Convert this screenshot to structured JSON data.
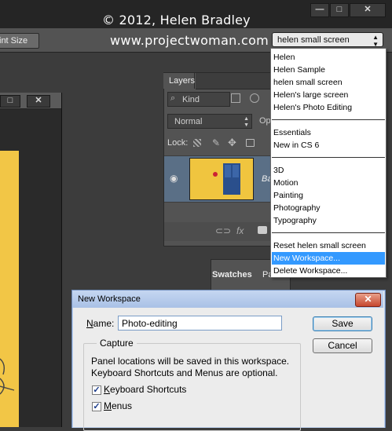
{
  "watermark": {
    "line1": "© 2012, Helen Bradley",
    "line2": "www.projectwoman.com"
  },
  "app_window": {
    "minimize": "—",
    "maximize": "□",
    "close": "✕"
  },
  "options_bar": {
    "print_size_label": "int Size",
    "workspace_select_value": "helen small screen"
  },
  "document_window": {
    "maximize": "□",
    "close": "✕"
  },
  "layers_panel": {
    "tab_label": "Layers",
    "kind_label": "Kind",
    "blend_mode": "Normal",
    "opacity_label": "Op",
    "lock_label": "Lock:",
    "layer_name": "Ba"
  },
  "swatches_panel": {
    "swatches_tab": "Swatches",
    "paths_tab": "Path"
  },
  "workspace_menu": {
    "group1": [
      "Helen",
      "Helen Sample",
      "helen small screen",
      "Helen's large screen",
      "Helen's Photo Editing"
    ],
    "group2": [
      "Essentials",
      "New in CS 6"
    ],
    "group3": [
      "3D",
      "Motion",
      "Painting",
      "Photography",
      "Typography"
    ],
    "group4": [
      "Reset helen small screen",
      "New Workspace...",
      "Delete Workspace..."
    ],
    "highlighted": "New Workspace..."
  },
  "dialog": {
    "title": "New Workspace",
    "name_label": "Name:",
    "name_value": "Photo-editing",
    "save_label": "Save",
    "cancel_label": "Cancel",
    "capture_label": "Capture",
    "info_line1": "Panel locations will be saved in this workspace.",
    "info_line2": "Keyboard Shortcuts and Menus are optional.",
    "checkbox1_label": "Keyboard Shortcuts",
    "checkbox1_checked": true,
    "checkbox2_label": "Menus",
    "checkbox2_checked": true,
    "close_glyph": "✕"
  }
}
